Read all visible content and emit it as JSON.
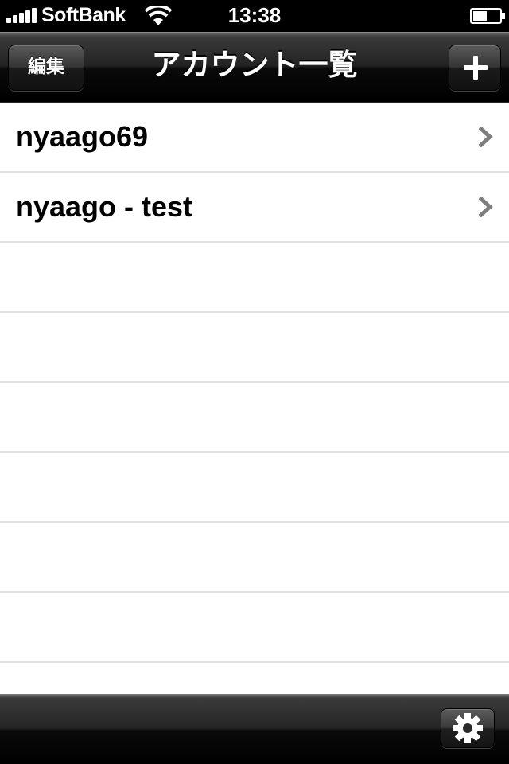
{
  "status_bar": {
    "carrier": "SoftBank",
    "time": "13:38",
    "icons": [
      "signal-bars-icon",
      "wifi-icon",
      "battery-icon"
    ]
  },
  "nav_bar": {
    "title": "アカウント一覧",
    "edit_label": "編集",
    "add_icon": "plus-icon"
  },
  "accounts": [
    {
      "name": "nyaago69",
      "accessory": "chevron-right-icon"
    },
    {
      "name": "nyaago - test",
      "accessory": "chevron-right-icon"
    }
  ],
  "toolbar": {
    "settings_icon": "gear-icon"
  },
  "colors": {
    "bar_dark": "#000000",
    "separator": "#e0e0e0",
    "chevron": "#7f7f7f",
    "text": "#000000"
  }
}
